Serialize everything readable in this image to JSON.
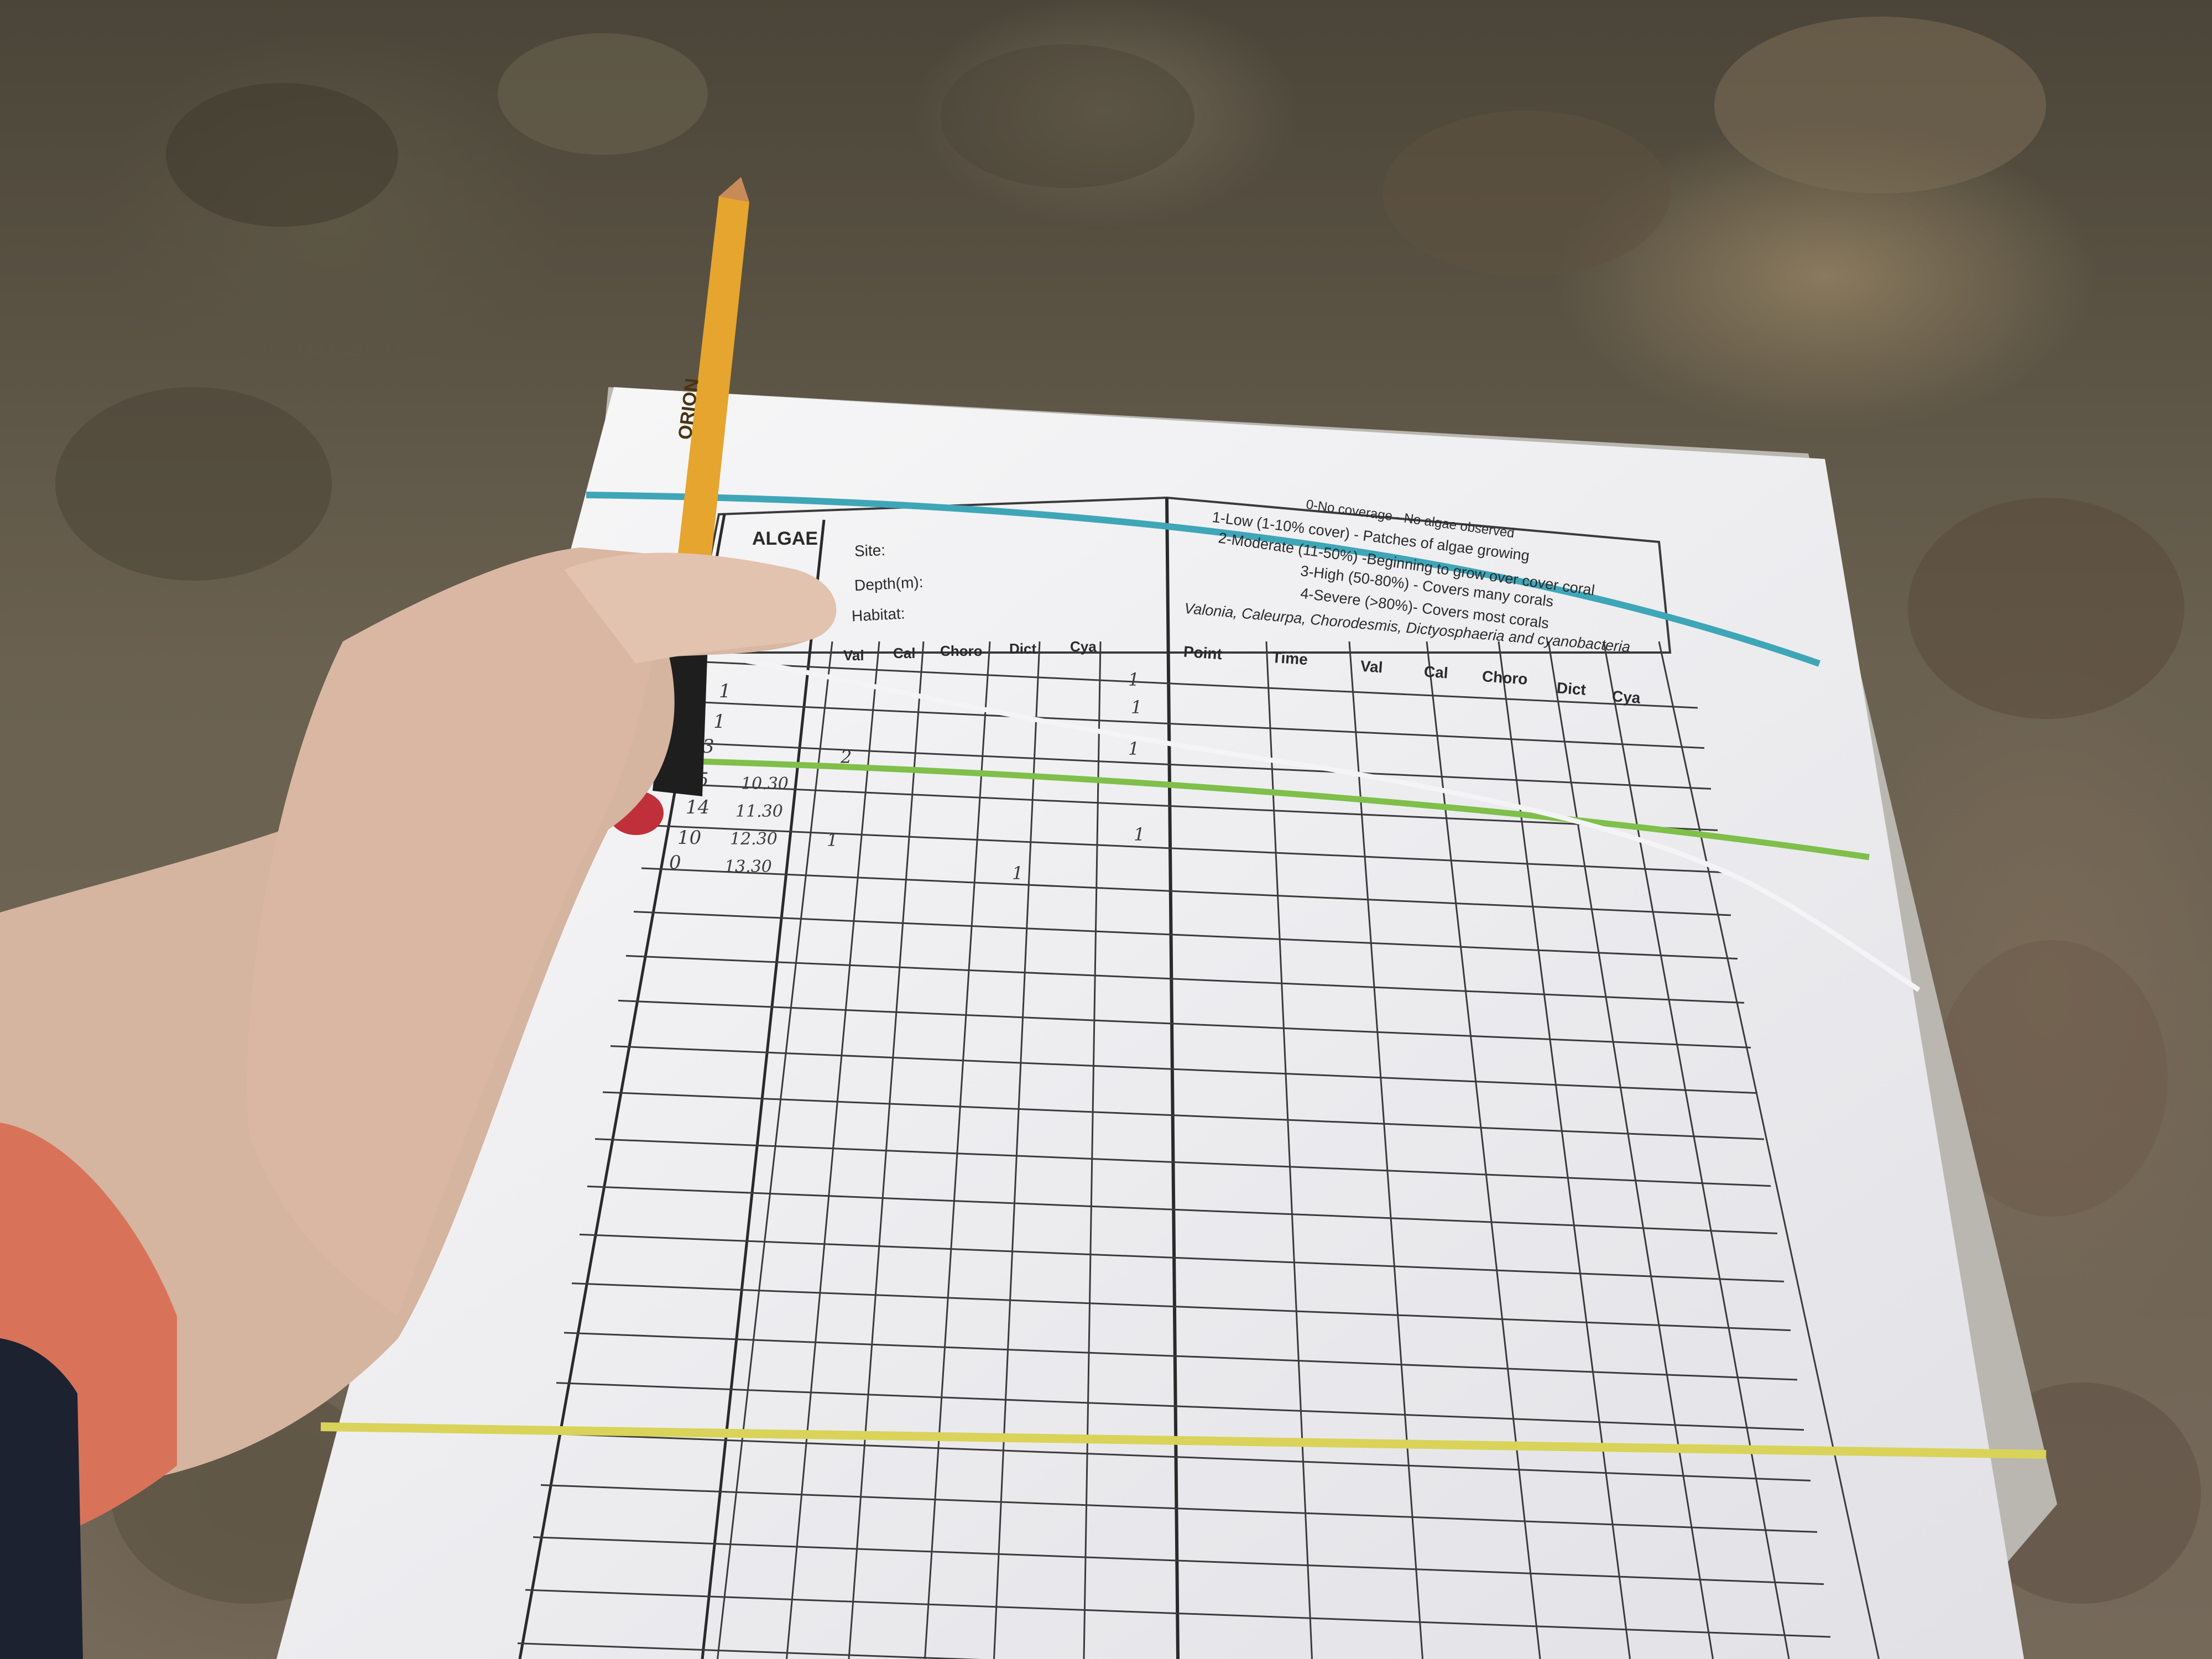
{
  "form": {
    "title": "ALGAE",
    "site_label": "Site:",
    "depth_label": "Depth(m):",
    "habitat_label": "Habitat:",
    "legend": [
      "0-No coverage - No algae observed",
      "1-Low (1-10% cover) - Patches of algae growing",
      "2-Moderate (11-50%) -Beginning to grow over cover coral",
      "3-High (50-80%) - Covers many corals",
      "4-Severe (>80%)- Covers most corals"
    ],
    "legend_species": "Valonia, Caleurpa, Chorodesmis, Dictyosphaeria and cyanobacteria",
    "left_columns": [
      "Val",
      "Cal",
      "Choro",
      "Dict",
      "Cya"
    ],
    "right_columns": [
      "Point",
      "Time",
      "Val",
      "Cal",
      "Choro",
      "Dict",
      "Cya"
    ]
  },
  "handwriting": {
    "points": [
      "1",
      "1",
      "3",
      "5",
      "14",
      "10",
      "0"
    ],
    "times": [
      "10.30",
      "11.30",
      "12.30",
      "13.30"
    ],
    "marks": [
      "1",
      "1",
      "1",
      "2",
      "1",
      "1",
      "1"
    ]
  },
  "pencil_brand": "ORION",
  "colors": {
    "paper": "#f1f1f3",
    "grid_line": "#3a3a3a",
    "band_blue": "#3fa6b8",
    "band_green": "#7fbf4a",
    "band_yellow": "#d9d35a",
    "pencil_body": "#e6a52e",
    "skin": "#d9b7a3"
  }
}
